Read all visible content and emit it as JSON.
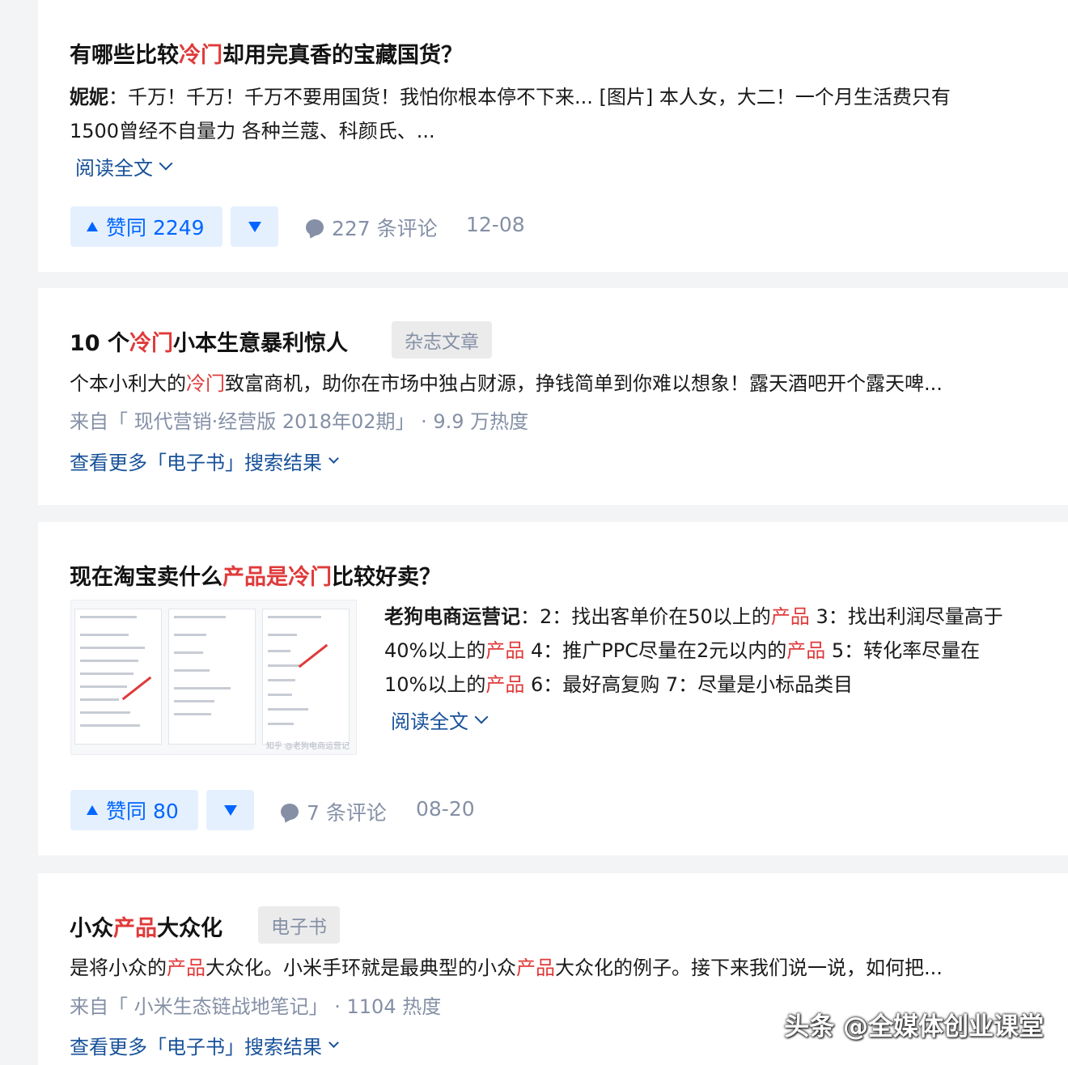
{
  "cards": [
    {
      "title_parts": [
        "有哪些比较",
        "冷门",
        "却用完真香的宝藏国货？"
      ],
      "author": "妮妮",
      "excerpt_line1": "：千万！千万！千万不要用国货！我怕你根本停不下来... [图片] 本人女，大二！一个月生活费只有",
      "excerpt_line2": "1500曾经不自量力 各种兰蔻、科颜氏、...",
      "read_more": "阅读全文",
      "upvote_label": "赞同 2249",
      "comments": "227 条评论",
      "date": "12-08"
    },
    {
      "title_parts": [
        "10 个",
        "冷门",
        "小本生意暴利惊人"
      ],
      "tag": "杂志文章",
      "excerpt_parts": [
        "个本小利大的",
        "冷门",
        "致富商机，助你在市场中独占财源，挣钱简单到你难以想象！露天酒吧开个露天啤..."
      ],
      "source": "来自「 现代营销·经营版 2018年02期」 · 9.9 万热度",
      "more_link": "查看更多「电子书」搜索结果"
    },
    {
      "title_parts": [
        "现在淘宝卖什么",
        "产品是冷门",
        "比较好卖？"
      ],
      "author": "老狗电商运营记",
      "excerpt_l1": [
        "：2：找出客单价在50以上的",
        "产品",
        " 3：找出利润尽量高于"
      ],
      "excerpt_l2": [
        "40%以上的",
        "产品",
        " 4：推广PPC尽量在2元以内的",
        "产品",
        " 5：转化率尽量在"
      ],
      "excerpt_l3": [
        "10%以上的",
        "产品",
        " 6：最好高复购 7：尽量是小标品类目"
      ],
      "read_more": "阅读全文",
      "upvote_label": "赞同 80",
      "comments": "7 条评论",
      "date": "08-20",
      "thumb_caption": "知乎 @老狗电商运营记"
    },
    {
      "title_parts": [
        "小众",
        "产品",
        "大众化"
      ],
      "tag": "电子书",
      "excerpt_parts": [
        "是将小众的",
        "产品",
        "大众化。小米手环就是最典型的小众",
        "产品",
        "大众化的例子。接下来我们说一说，如何把..."
      ],
      "source": "来自「 小米生态链战地笔记」 · 1104 热度",
      "more_link": "查看更多「电子书」搜索结果"
    }
  ],
  "watermark": "头条 @全媒体创业课堂",
  "colors": {
    "highlight": "#e03a3a",
    "link": "#175199",
    "accent": "#0066ff",
    "muted": "#8590a6"
  },
  "icons": [
    "triangle-up-icon",
    "triangle-down-icon",
    "comment-bubble-icon",
    "chevron-down-icon"
  ]
}
